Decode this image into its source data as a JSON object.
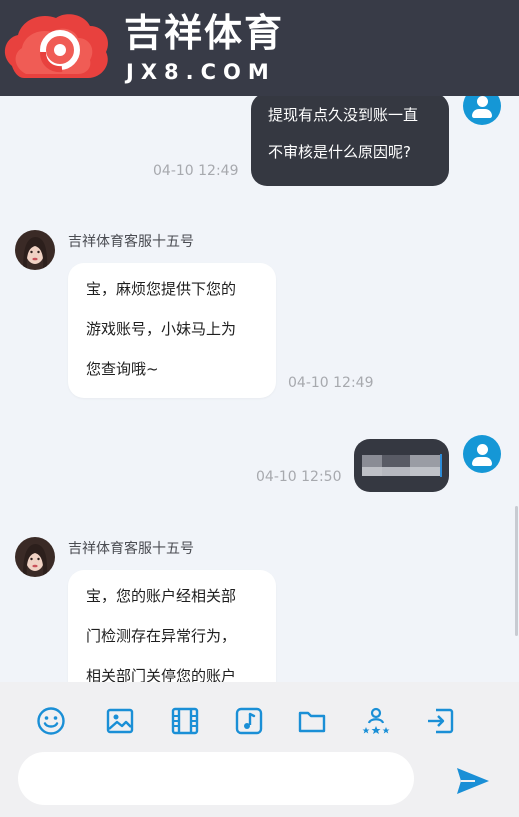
{
  "header": {
    "brand_cn": "吉祥体育",
    "brand_en": "JX8.COM"
  },
  "messages": [
    {
      "id": "m1",
      "from": "user",
      "lines": [
        "提现有点久没到账一直",
        "不审核是什么原因呢?"
      ],
      "time": "04-10 12:49"
    },
    {
      "id": "m2",
      "from": "agent",
      "sender": "吉祥体育客服十五号",
      "lines": [
        "宝，麻烦您提供下您的",
        "游戏账号，小妹马上为",
        "您查询哦~"
      ],
      "time": "04-10 12:49"
    },
    {
      "id": "m3",
      "from": "user",
      "lines": [],
      "time": "04-10 12:50",
      "redacted": true
    },
    {
      "id": "m4",
      "from": "agent",
      "sender": "吉祥体育客服十五号",
      "lines": [
        "宝，您的账户经相关部",
        "门检测存在异常行为，",
        "相关部门关停您的账户"
      ]
    }
  ],
  "toolbar": {
    "icons": [
      "emoji-icon",
      "image-icon",
      "video-icon",
      "music-icon",
      "folder-icon",
      "rating-icon",
      "logout-icon"
    ],
    "accent": "#1a8fd6"
  },
  "composer": {
    "value": "",
    "placeholder": ""
  },
  "colors": {
    "header_bg": "#383b47",
    "user_bubble": "#353841",
    "chat_bg": "#f1f4f9",
    "brand_red": "#e8413e"
  }
}
